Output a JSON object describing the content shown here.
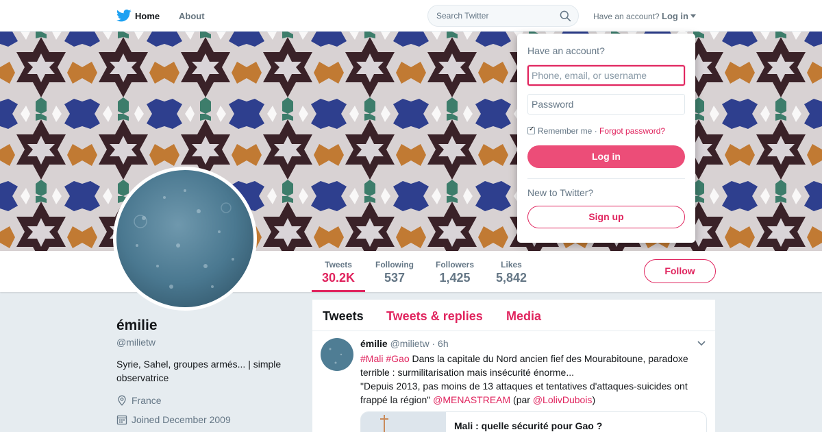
{
  "topnav": {
    "home_label": "Home",
    "about_label": "About",
    "search_placeholder": "Search Twitter",
    "have_account": "Have an account?",
    "login_label": "Log in"
  },
  "profile": {
    "name": "émilie",
    "handle": "@milietw",
    "bio": "Syrie, Sahel, groupes armés... | simple observatrice",
    "location": "France",
    "joined": "Joined December 2009"
  },
  "stats": [
    {
      "label": "Tweets",
      "value": "30.2K"
    },
    {
      "label": "Following",
      "value": "537"
    },
    {
      "label": "Followers",
      "value": "1,425"
    },
    {
      "label": "Likes",
      "value": "5,842"
    }
  ],
  "follow_label": "Follow",
  "timeline": {
    "tabs": [
      "Tweets",
      "Tweets & replies",
      "Media"
    ],
    "tweet": {
      "name": "émilie",
      "handle": "@milietw",
      "time": "· 6h",
      "hashtag1": "#Mali",
      "hashtag2": "#Gao",
      "text1": " Dans la capitale du Nord ancien fief des Mourabitoune, paradoxe terrible : surmilitarisation mais insécurité énorme...",
      "text2": "\"Depuis 2013, pas moins de 13 attaques et tentatives d'attaques-suicides ont frappé la région\" ",
      "mention1": "@MENASTREAM",
      "text3": " (par ",
      "mention2": "@LolivDubois",
      "text4": ")",
      "card_title": "Mali : quelle sécurité pour Gao ?"
    }
  },
  "login_dropdown": {
    "title": "Have an account?",
    "username_placeholder": "Phone, email, or username",
    "password_placeholder": "Password",
    "remember": "Remember me",
    "separator": " · ",
    "forgot": "Forgot password?",
    "login_button": "Log in",
    "new_to_twitter": "New to Twitter?",
    "signup_button": "Sign up"
  },
  "colors": {
    "accent": "#e0245e",
    "twitter_blue": "#1da1f2",
    "button_fill": "#ec4d78"
  },
  "icons": [
    "twitter-bird-icon",
    "search-icon",
    "caret-down-icon",
    "location-icon",
    "calendar-icon",
    "chevron-down-icon"
  ]
}
